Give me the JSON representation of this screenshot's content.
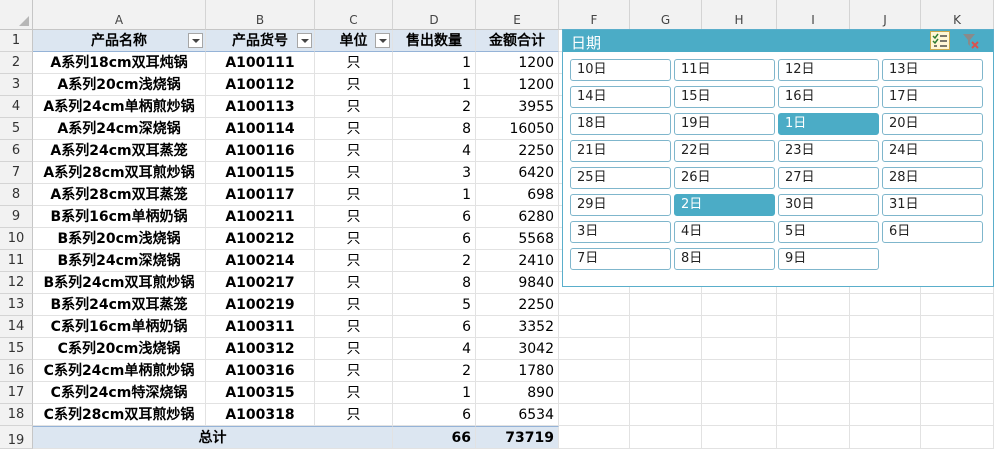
{
  "columns": [
    "A",
    "B",
    "C",
    "D",
    "E",
    "F",
    "G",
    "H",
    "I",
    "J",
    "K"
  ],
  "rows": [
    "1",
    "2",
    "3",
    "4",
    "5",
    "6",
    "7",
    "8",
    "9",
    "10",
    "11",
    "12",
    "13",
    "14",
    "15",
    "16",
    "17",
    "18",
    "19"
  ],
  "table": {
    "headers": [
      "产品名称",
      "产品货号",
      "单位",
      "售出数量",
      "金额合计"
    ],
    "data": [
      [
        "A系列18cm双耳炖锅",
        "A100111",
        "只",
        "1",
        "1200"
      ],
      [
        "A系列20cm浅烧锅",
        "A100112",
        "只",
        "1",
        "1200"
      ],
      [
        "A系列24cm单柄煎炒锅",
        "A100113",
        "只",
        "2",
        "3955"
      ],
      [
        "A系列24cm深烧锅",
        "A100114",
        "只",
        "8",
        "16050"
      ],
      [
        "A系列24cm双耳蒸笼",
        "A100116",
        "只",
        "4",
        "2250"
      ],
      [
        "A系列28cm双耳煎炒锅",
        "A100115",
        "只",
        "3",
        "6420"
      ],
      [
        "A系列28cm双耳蒸笼",
        "A100117",
        "只",
        "1",
        "698"
      ],
      [
        "B系列16cm单柄奶锅",
        "A100211",
        "只",
        "6",
        "6280"
      ],
      [
        "B系列20cm浅烧锅",
        "A100212",
        "只",
        "6",
        "5568"
      ],
      [
        "B系列24cm深烧锅",
        "A100214",
        "只",
        "2",
        "2410"
      ],
      [
        "B系列24cm双耳煎炒锅",
        "A100217",
        "只",
        "8",
        "9840"
      ],
      [
        "B系列24cm双耳蒸笼",
        "A100219",
        "只",
        "5",
        "2250"
      ],
      [
        "C系列16cm单柄奶锅",
        "A100311",
        "只",
        "6",
        "3352"
      ],
      [
        "C系列20cm浅烧锅",
        "A100312",
        "只",
        "4",
        "3042"
      ],
      [
        "C系列24cm单柄煎炒锅",
        "A100316",
        "只",
        "2",
        "1780"
      ],
      [
        "C系列24cm特深烧锅",
        "A100315",
        "只",
        "1",
        "890"
      ],
      [
        "C系列28cm双耳煎炒锅",
        "A100318",
        "只",
        "6",
        "6534"
      ]
    ],
    "total": {
      "label": "总计",
      "qty": "66",
      "amount": "73719"
    }
  },
  "slicer": {
    "title": "日期",
    "items": [
      "10日",
      "11日",
      "12日",
      "13日",
      "14日",
      "15日",
      "16日",
      "17日",
      "18日",
      "19日",
      "1日",
      "20日",
      "21日",
      "22日",
      "23日",
      "24日",
      "25日",
      "26日",
      "27日",
      "28日",
      "29日",
      "2日",
      "30日",
      "31日",
      "3日",
      "4日",
      "5日",
      "6日",
      "7日",
      "8日",
      "9日"
    ],
    "selected": [
      "1日",
      "2日"
    ],
    "accent": "#4bacc6"
  }
}
